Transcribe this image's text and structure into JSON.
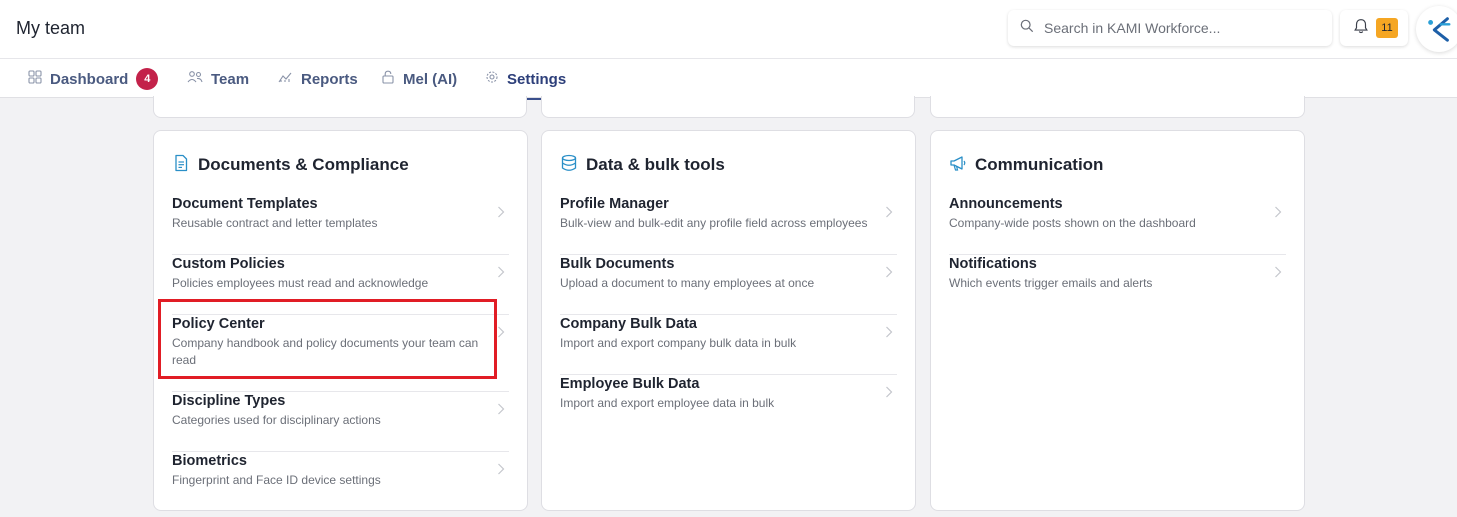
{
  "header": {
    "title": "My team",
    "search_placeholder": "Search in KAMI Workforce...",
    "notification_count": "11",
    "icons": {
      "search": "search-icon",
      "bell": "bell-icon",
      "logo": "kami-logo-icon"
    }
  },
  "nav": {
    "tabs": [
      {
        "label": "Dashboard",
        "icon": "grid-icon",
        "badge": "4"
      },
      {
        "label": "Team",
        "icon": "users-icon"
      },
      {
        "label": "Reports",
        "icon": "reports-icon"
      },
      {
        "label": "Mel (AI)",
        "icon": "lock-icon"
      },
      {
        "label": "Settings",
        "icon": "gear-icon",
        "active": true
      }
    ]
  },
  "cards": [
    {
      "title": "Documents & Compliance",
      "icon": "document-icon",
      "items": [
        {
          "title": "Document Templates",
          "desc": "Reusable contract and letter templates"
        },
        {
          "title": "Custom Policies",
          "desc": "Policies employees must read and acknowledge"
        },
        {
          "title": "Policy Center",
          "desc": "Company handbook and policy documents your team can read"
        },
        {
          "title": "Discipline Types",
          "desc": "Categories used for disciplinary actions"
        },
        {
          "title": "Biometrics",
          "desc": "Fingerprint and Face ID device settings"
        }
      ]
    },
    {
      "title": "Data & bulk tools",
      "icon": "database-icon",
      "items": [
        {
          "title": "Profile Manager",
          "desc": "Bulk-view and bulk-edit any profile field across employees"
        },
        {
          "title": "Bulk Documents",
          "desc": "Upload a document to many employees at once"
        },
        {
          "title": "Company Bulk Data",
          "desc": "Import and export company bulk data in bulk"
        },
        {
          "title": "Employee Bulk Data",
          "desc": "Import and export employee data in bulk"
        }
      ]
    },
    {
      "title": "Communication",
      "icon": "megaphone-icon",
      "items": [
        {
          "title": "Announcements",
          "desc": "Company-wide posts shown on the dashboard"
        },
        {
          "title": "Notifications",
          "desc": "Which events trigger emails and alerts"
        }
      ]
    }
  ],
  "colors": {
    "accent": "#2d3f7a",
    "badge": "#c3224a",
    "notification": "#f5a623",
    "highlight": "#e11d25",
    "card_icon": "#2a8fc7"
  }
}
